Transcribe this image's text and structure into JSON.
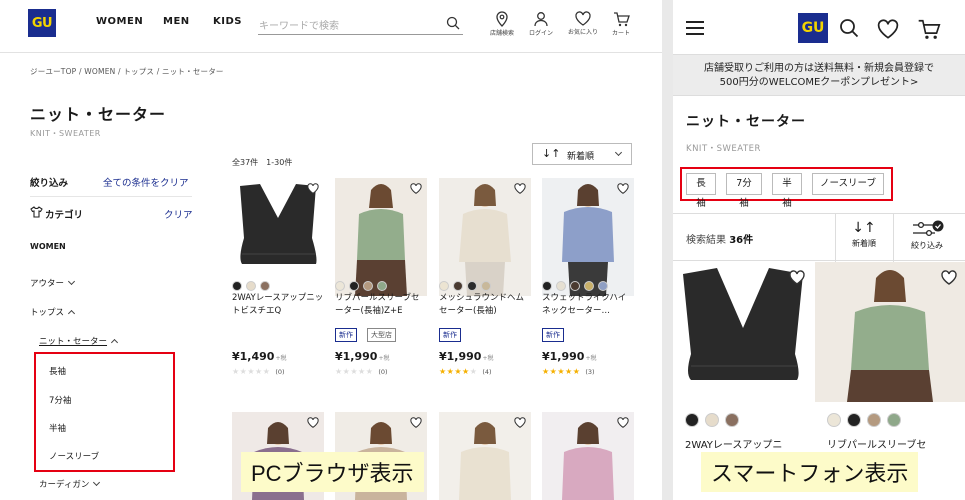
{
  "pc": {
    "logo": "GU",
    "nav": [
      "WOMEN",
      "MEN",
      "KIDS"
    ],
    "search": {
      "placeholder": "キーワードで検索"
    },
    "header_icons": [
      {
        "icon": "location-pin-icon",
        "label": "店舗検索"
      },
      {
        "icon": "user-icon",
        "label": "ログイン"
      },
      {
        "icon": "heart-icon",
        "label": "お気に入り"
      },
      {
        "icon": "cart-icon",
        "label": "カート"
      }
    ],
    "breadcrumb": "ジーユーTOP / WOMEN / トップス / ニット・セーター",
    "title": "ニット・セーター",
    "subtitle": "KNIT・SWEATER",
    "filter": {
      "label": "絞り込み",
      "clear_all": "全ての条件をクリア",
      "category": "カテゴリ",
      "clear": "クリア",
      "women": "WOMEN",
      "outer": "アウター",
      "tops": "トップス",
      "knit": "ニット・セーター",
      "sub_items": [
        "長袖",
        "7分袖",
        "半袖",
        "ノースリーブ"
      ],
      "cardigan": "カーディガン"
    },
    "count": "全37件　1-30件",
    "sort": {
      "arrow": "↓↑",
      "label": "新着順"
    },
    "products": [
      {
        "name": "2WAYレースアップニットビスチエQ",
        "tags": [],
        "price": "¥1,490",
        "tax": "+税",
        "rating": 0,
        "reviews": "(0)",
        "swatches": [
          "#222222",
          "#e6dccb",
          "#8a7060"
        ]
      },
      {
        "name": "リブパールスリーブセーター(長袖)Z+E",
        "tags": [
          "新作",
          "大型店"
        ],
        "price": "¥1,990",
        "tax": "+税",
        "rating": 0,
        "reviews": "(0)",
        "swatches": [
          "#ece6d8",
          "#222222",
          "#b49a80",
          "#8fa88a"
        ]
      },
      {
        "name": "メッシュラウンドヘムセーター(長袖)",
        "tags": [
          "新作"
        ],
        "price": "¥1,990",
        "tax": "+税",
        "rating": 4,
        "reviews": "(4)",
        "swatches": [
          "#ece4d2",
          "#4a3a30",
          "#2c2c2c",
          "#c8b89a"
        ]
      },
      {
        "name": "スウェットライクハイネックセーター…",
        "tags": [
          "新作"
        ],
        "price": "¥1,990",
        "tax": "+税",
        "rating": 5,
        "reviews": "(3)",
        "swatches": [
          "#222222",
          "#e6e0d2",
          "#4a3a30",
          "#c8b06a",
          "#8f9fc4"
        ]
      }
    ],
    "caption": "PCブラウザ表示"
  },
  "sp": {
    "logo": "GU",
    "banner_line1": "店舗受取りご利用の方は送料無料・新規会員登録で",
    "banner_line2": "500円分のWELCOMEクーポンプレゼント>",
    "title": "ニット・セーター",
    "subtitle": "KNIT・SWEATER",
    "chips": [
      "長袖",
      "7分袖",
      "半袖",
      "ノースリーブ"
    ],
    "result_label": "検索結果",
    "result_count": "36件",
    "sort": {
      "arrow": "↓↑",
      "label": "新着順"
    },
    "filter_label": "絞り込み",
    "products": [
      {
        "name": "2WAYレースアップニ",
        "swatches": [
          "#222222",
          "#e6dccb",
          "#8a7060"
        ]
      },
      {
        "name": "リブパールスリーブセ",
        "swatches": [
          "#ece6d8",
          "#222222",
          "#b49a80",
          "#8fa88a"
        ]
      }
    ],
    "caption": "スマートフォン表示"
  },
  "colors": {
    "brand_blue": "#1a2d8f",
    "brand_yellow": "#f2d400",
    "highlight_red": "#e50012",
    "caption_bg": "#fdfbc9"
  }
}
